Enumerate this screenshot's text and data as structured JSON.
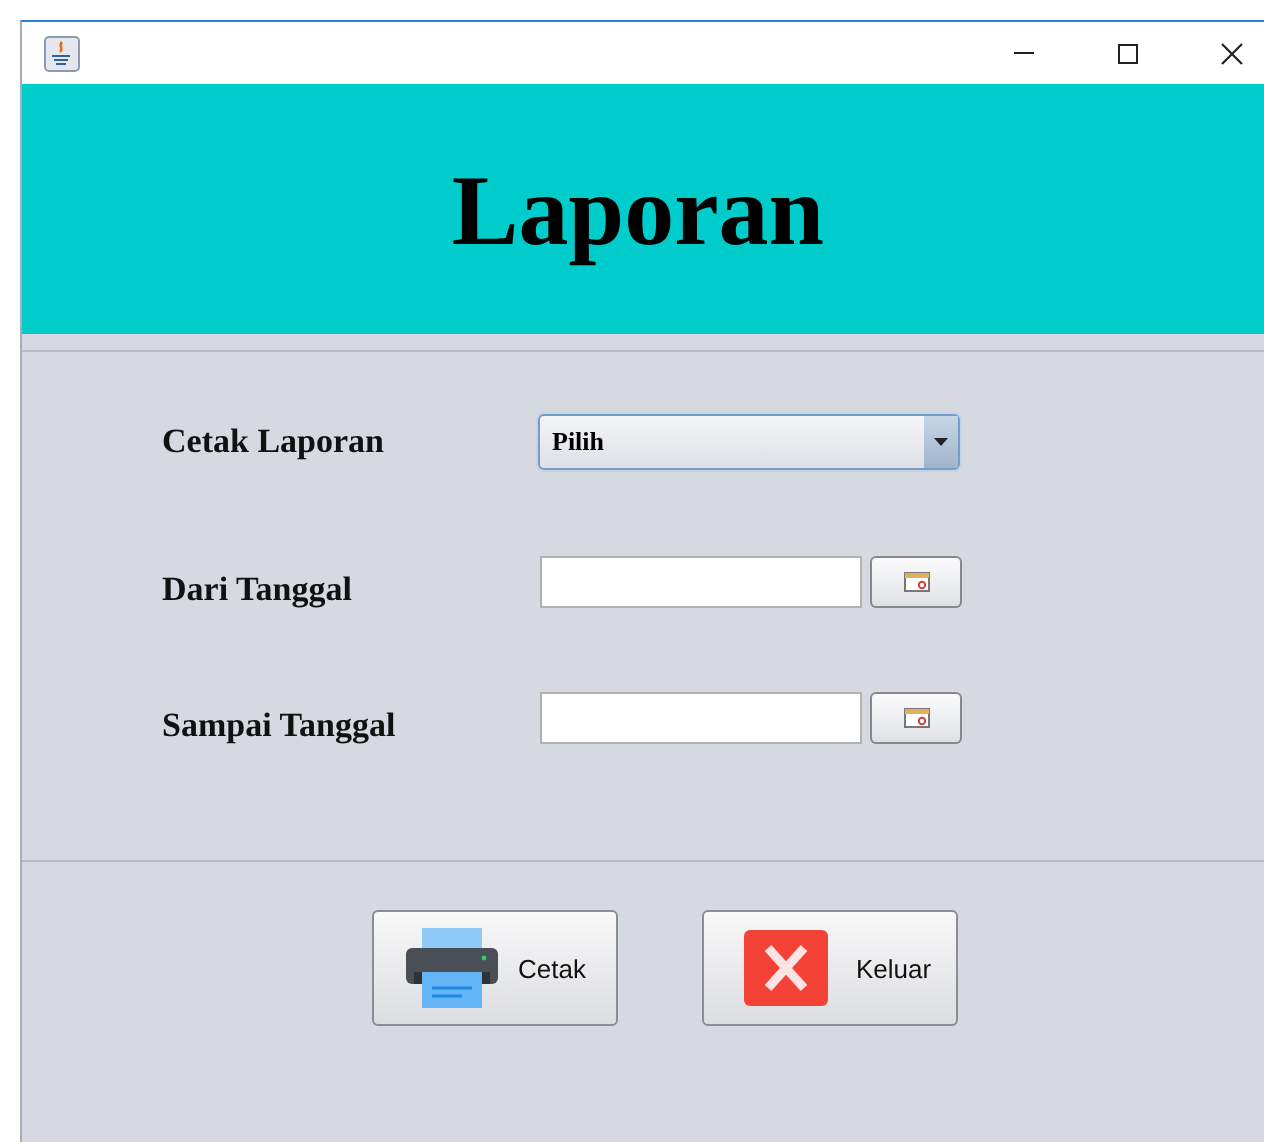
{
  "header": {
    "title": "Laporan"
  },
  "form": [
    {
      "kind": "combo",
      "label": "Cetak Laporan",
      "value": "Pilih"
    },
    {
      "kind": "date",
      "label": "Dari Tanggal"
    },
    {
      "kind": "date",
      "label": "Sampai Tanggal"
    }
  ],
  "buttons": [
    {
      "label": "Cetak"
    },
    {
      "label": "Keluar"
    }
  ]
}
